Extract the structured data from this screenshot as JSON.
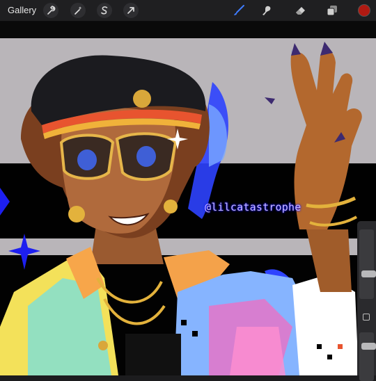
{
  "toolbar": {
    "gallery_label": "Gallery",
    "left_tools": [
      {
        "name": "actions",
        "icon": "wrench-icon"
      },
      {
        "name": "adjustments",
        "icon": "magic-wand-icon"
      },
      {
        "name": "selection",
        "icon": "selection-s-icon"
      },
      {
        "name": "transform",
        "icon": "arrow-cursor-icon"
      }
    ],
    "right_tools": [
      {
        "name": "brush",
        "icon": "brush-icon",
        "active": true
      },
      {
        "name": "smudge",
        "icon": "smudge-icon"
      },
      {
        "name": "eraser",
        "icon": "eraser-icon"
      },
      {
        "name": "layers",
        "icon": "layers-icon"
      }
    ],
    "active_color": "#b11a12",
    "accent_color": "#3f7cff"
  },
  "artwork": {
    "signature": "@lilcatastrophe"
  },
  "sidebar": {
    "brush_size": 0.35,
    "opacity": 0.75
  }
}
